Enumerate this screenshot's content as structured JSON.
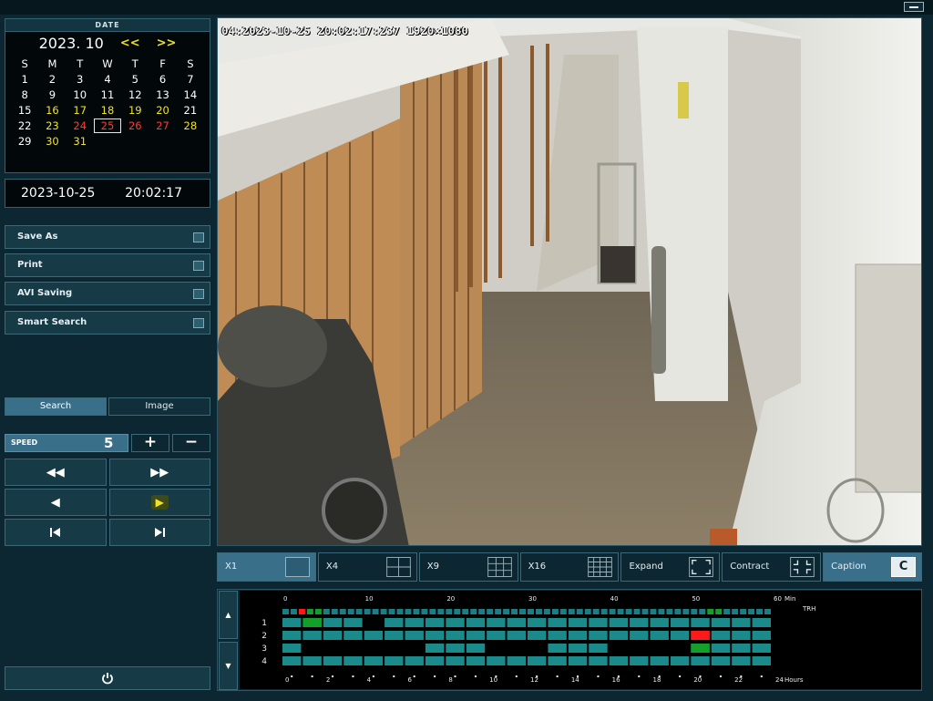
{
  "calendar": {
    "header": "DATE",
    "month_label": "2023. 10",
    "prev_label": "<<",
    "next_label": ">>",
    "weekdays": [
      "S",
      "M",
      "T",
      "W",
      "T",
      "F",
      "S"
    ],
    "days": [
      [
        "1",
        "2",
        "3",
        "4",
        "5",
        "6",
        "7"
      ],
      [
        "8",
        "9",
        "10",
        "11",
        "12",
        "13",
        "14"
      ],
      [
        "15",
        "16",
        "17",
        "18",
        "19",
        "20",
        "21"
      ],
      [
        "22",
        "23",
        "24",
        "25",
        "26",
        "27",
        "28"
      ],
      [
        "29",
        "30",
        "31",
        "",
        "",
        "",
        ""
      ]
    ],
    "recorded_days": [
      "16",
      "17",
      "18",
      "19",
      "20",
      "23",
      "28",
      "30",
      "31"
    ],
    "red_days": [
      "24",
      "26",
      "27"
    ],
    "selected_day": "25"
  },
  "clock": {
    "date": "2023-10-25",
    "time": "20:02:17"
  },
  "menu": {
    "save_as": "Save As",
    "print": "Print",
    "avi_saving": "AVI Saving",
    "smart_search": "Smart Search"
  },
  "tabs": {
    "search": "Search",
    "image": "Image"
  },
  "speed": {
    "label": "SPEED",
    "value": "5",
    "plus": "+",
    "minus": "−"
  },
  "video": {
    "osd": "04:2023-10-25 20:02:17:237 1920×1080"
  },
  "layouts": {
    "x1": "X1",
    "x4": "X4",
    "x9": "X9",
    "x16": "X16",
    "expand": "Expand",
    "contract": "Contract",
    "caption": "Caption",
    "caption_key": "C"
  },
  "timeline": {
    "min_ticks": [
      "0",
      "10",
      "20",
      "30",
      "40",
      "50",
      "60"
    ],
    "min_unit": "Min",
    "hour_ticks": [
      "0",
      "2",
      "4",
      "6",
      "8",
      "10",
      "12",
      "14",
      "16",
      "18",
      "20",
      "22",
      "24"
    ],
    "hour_unit": "Hours",
    "channels": [
      "1",
      "2",
      "3",
      "4"
    ],
    "corner_label": "TRH"
  },
  "colors": {
    "accent": "#3a6f8a",
    "record": "#1a8a8a",
    "event": "#12a02a",
    "alarm": "#ff1a1a",
    "calendar_record": "#f2e21d"
  }
}
